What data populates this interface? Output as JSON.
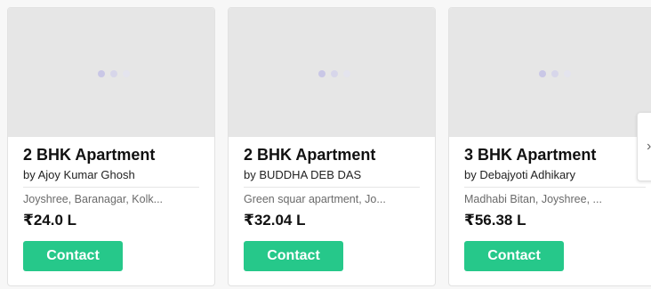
{
  "listings": [
    {
      "title": "2 BHK Apartment",
      "owner": "by Ajoy Kumar Ghosh",
      "location": "Joyshree, Baranagar, Kolk...",
      "price": "₹24.0 L",
      "cta": "Contact"
    },
    {
      "title": "2 BHK Apartment",
      "owner": "by BUDDHA DEB DAS",
      "location": "Green squar apartment, Jo...",
      "price": "₹32.04 L",
      "cta": "Contact"
    },
    {
      "title": "3 BHK Apartment",
      "owner": "by Debajyoti Adhikary",
      "location": "Madhabi Bitan, Joyshree, ...",
      "price": "₹56.38 L",
      "cta": "Contact"
    }
  ],
  "carousel": {
    "next_icon": "chevron-right-icon"
  },
  "colors": {
    "contact_button": "#26c88a",
    "image_placeholder": "#e6e6e6",
    "loader_dot": "#c9c7e6"
  }
}
